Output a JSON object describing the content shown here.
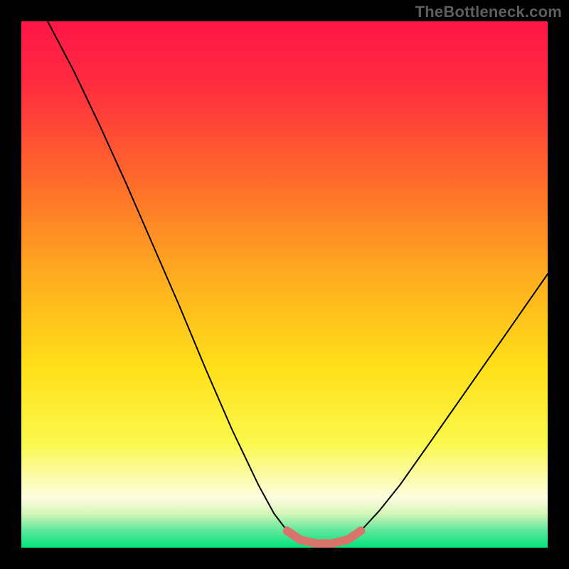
{
  "watermark": "TheBottleneck.com",
  "chart_data": {
    "type": "line",
    "title": "",
    "xlabel": "",
    "ylabel": "",
    "xlim": [
      0,
      100
    ],
    "ylim": [
      0,
      100
    ],
    "gradient_stops": [
      {
        "offset": 0.0,
        "color": "#ff1647"
      },
      {
        "offset": 0.12,
        "color": "#ff2c3f"
      },
      {
        "offset": 0.3,
        "color": "#ff6a2b"
      },
      {
        "offset": 0.5,
        "color": "#ffb21e"
      },
      {
        "offset": 0.66,
        "color": "#ffe019"
      },
      {
        "offset": 0.8,
        "color": "#fbf84c"
      },
      {
        "offset": 0.905,
        "color": "#fcfde0"
      },
      {
        "offset": 0.935,
        "color": "#d6f6b8"
      },
      {
        "offset": 0.965,
        "color": "#66e89e"
      },
      {
        "offset": 1.0,
        "color": "#00e47e"
      }
    ],
    "series": [
      {
        "name": "curve",
        "stroke": "#000000",
        "stroke_width": 2,
        "points": [
          {
            "x": 5.0,
            "y": 100.0
          },
          {
            "x": 10.0,
            "y": 90.5
          },
          {
            "x": 15.0,
            "y": 80.0
          },
          {
            "x": 20.0,
            "y": 69.0
          },
          {
            "x": 25.0,
            "y": 57.5
          },
          {
            "x": 30.0,
            "y": 46.0
          },
          {
            "x": 35.0,
            "y": 34.0
          },
          {
            "x": 40.0,
            "y": 22.5
          },
          {
            "x": 45.0,
            "y": 12.0
          },
          {
            "x": 48.0,
            "y": 6.5
          },
          {
            "x": 50.5,
            "y": 3.2
          },
          {
            "x": 53.0,
            "y": 1.5
          },
          {
            "x": 56.0,
            "y": 0.8
          },
          {
            "x": 59.0,
            "y": 0.8
          },
          {
            "x": 62.0,
            "y": 1.5
          },
          {
            "x": 64.5,
            "y": 3.2
          },
          {
            "x": 68.0,
            "y": 7.0
          },
          {
            "x": 72.0,
            "y": 12.0
          },
          {
            "x": 78.0,
            "y": 20.5
          },
          {
            "x": 85.0,
            "y": 30.5
          },
          {
            "x": 92.0,
            "y": 40.5
          },
          {
            "x": 100.0,
            "y": 52.0
          }
        ]
      },
      {
        "name": "bottleneck-highlight",
        "stroke": "#d8756b",
        "stroke_width": 12,
        "linecap": "round",
        "points": [
          {
            "x": 50.5,
            "y": 3.2
          },
          {
            "x": 53.0,
            "y": 1.5
          },
          {
            "x": 56.0,
            "y": 0.8
          },
          {
            "x": 59.0,
            "y": 0.8
          },
          {
            "x": 62.0,
            "y": 1.5
          },
          {
            "x": 64.5,
            "y": 3.2
          }
        ]
      }
    ]
  }
}
